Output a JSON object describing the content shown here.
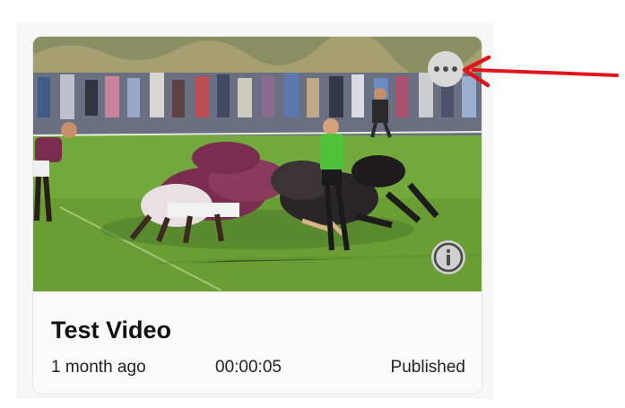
{
  "card": {
    "title": "Test Video",
    "age": "1 month ago",
    "duration": "00:00:05",
    "status": "Published"
  },
  "icons": {
    "more": "more-horizontal-icon",
    "info": "info-icon"
  },
  "colors": {
    "annotation_arrow": "#e0141c",
    "pitch_green": "#6fa83a",
    "kit_maroon": "#7b2d4f",
    "referee_green": "#4ec23a"
  }
}
